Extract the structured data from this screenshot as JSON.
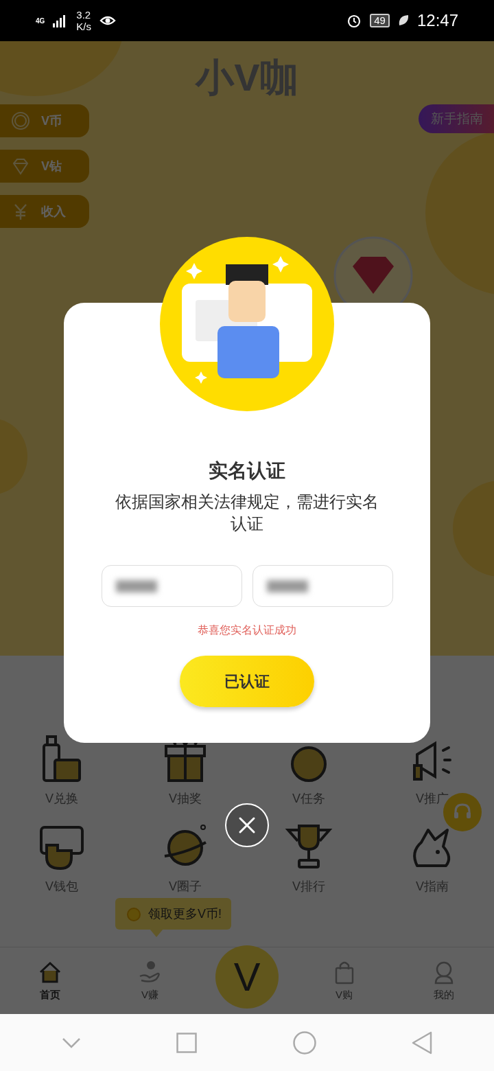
{
  "status_bar": {
    "network": "4G",
    "speed": [
      "3.2",
      "K/s"
    ],
    "battery": "49",
    "time": "12:47"
  },
  "app_title": "小V咖",
  "wallet_items": [
    {
      "label": "V币"
    },
    {
      "label": "V钻"
    },
    {
      "label": "收入"
    }
  ],
  "guide_button": "新手指南",
  "features": [
    {
      "label": "V兑换"
    },
    {
      "label": "V抽奖"
    },
    {
      "label": "V任务"
    },
    {
      "label": "V推广"
    },
    {
      "label": "V钱包"
    },
    {
      "label": "V圈子"
    },
    {
      "label": "V排行"
    },
    {
      "label": "V指南"
    }
  ],
  "tooltip": "领取更多V币!",
  "tab_bar": [
    {
      "label": "首页",
      "selected": true
    },
    {
      "label": "V赚",
      "selected": false
    },
    {
      "label": "V购",
      "selected": false
    },
    {
      "label": "我的",
      "selected": false
    }
  ],
  "center_button": "V",
  "dialog": {
    "title": "实名认证",
    "message": "依据国家相关法律规定，需进行实名认证",
    "fields": [
      {
        "redacted": true
      },
      {
        "redacted": true
      }
    ],
    "status": "恭喜您实名认证成功",
    "button": "已认证"
  }
}
